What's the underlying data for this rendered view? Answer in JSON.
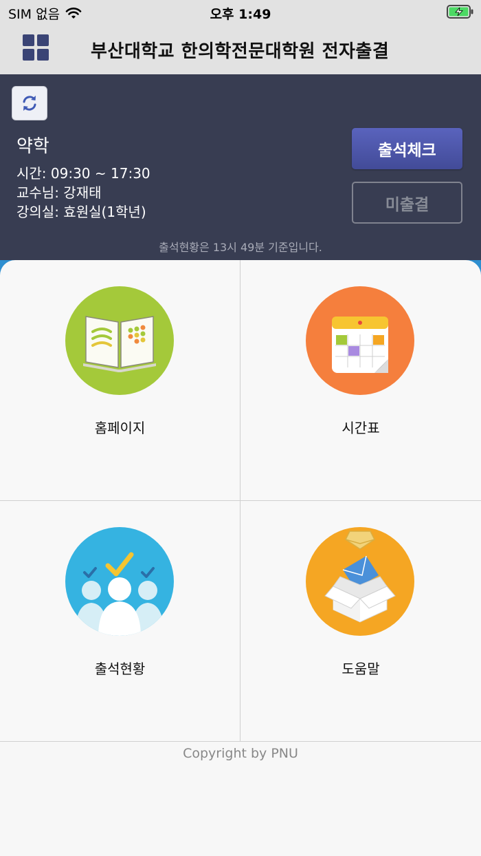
{
  "status_bar": {
    "carrier": "SIM 없음",
    "time": "오후 1:49",
    "icons": [
      "wifi-icon",
      "battery-charging-icon"
    ]
  },
  "header": {
    "title": "부산대학교 한의학전문대학원 전자출결",
    "menu_icon": "grid-menu-icon"
  },
  "course": {
    "name": "약학",
    "time": "시간: 09:30 ~ 17:30",
    "professor": "교수님: 강재태",
    "room": "강의실: 효원실(1학년)",
    "attend_button": "출석체크",
    "absent_button": "미출결",
    "status_note": "출석현황은 13시 49분 기준입니다."
  },
  "menu": [
    {
      "label": "홈페이지",
      "icon": "book-icon",
      "color": "#a4c93a"
    },
    {
      "label": "시간표",
      "icon": "calendar-icon",
      "color": "#f57f3d"
    },
    {
      "label": "출석현황",
      "icon": "people-check-icon",
      "color": "#35b3e1"
    },
    {
      "label": "도움말",
      "icon": "box-mail-icon",
      "color": "#f5a623"
    }
  ],
  "footer": {
    "copyright": "Copyright by PNU"
  },
  "colors": {
    "panel_bg": "#383d52",
    "attend_button": "#4f58ac",
    "header_bg": "#e2e2e2",
    "accent_blue": "#2e8fd0"
  }
}
